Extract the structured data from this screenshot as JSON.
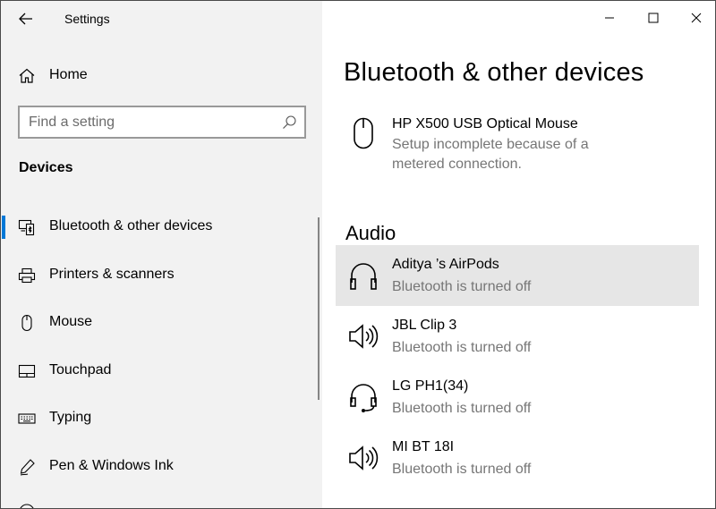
{
  "window": {
    "app_title": "Settings",
    "caption_buttons": [
      "minimize-icon",
      "maximize-icon",
      "close-icon"
    ]
  },
  "sidebar": {
    "home_label": "Home",
    "search": {
      "placeholder": "Find a setting",
      "value": ""
    },
    "section_label": "Devices",
    "items": [
      {
        "label": "Bluetooth & other devices",
        "icon": "bluetooth-devices-icon",
        "active": true
      },
      {
        "label": "Printers & scanners",
        "icon": "printer-icon",
        "active": false
      },
      {
        "label": "Mouse",
        "icon": "mouse-icon",
        "active": false
      },
      {
        "label": "Touchpad",
        "icon": "touchpad-icon",
        "active": false
      },
      {
        "label": "Typing",
        "icon": "keyboard-icon",
        "active": false
      },
      {
        "label": "Pen & Windows Ink",
        "icon": "pen-icon",
        "active": false
      }
    ]
  },
  "main": {
    "title": "Bluetooth & other devices",
    "mouse_device": {
      "name": "HP X500 USB Optical Mouse",
      "status_line1": "Setup incomplete because of a",
      "status_line2": "metered connection.",
      "icon": "mouse-icon"
    },
    "audio_section": {
      "heading": "Audio",
      "devices": [
        {
          "name": "Aditya ’s AirPods",
          "status": "Bluetooth is turned off",
          "icon": "headphones-icon",
          "selected": true
        },
        {
          "name": "JBL Clip 3",
          "status": "Bluetooth is turned off",
          "icon": "speaker-icon",
          "selected": false
        },
        {
          "name": "LG PH1(34)",
          "status": "Bluetooth is turned off",
          "icon": "headset-icon",
          "selected": false
        },
        {
          "name": "MI BT 18I",
          "status": "Bluetooth is turned off",
          "icon": "speaker-icon",
          "selected": false
        }
      ]
    }
  },
  "colors": {
    "accent": "#0078d7",
    "sidebar_bg": "#f2f2f2",
    "selected_bg": "#e6e6e6",
    "secondary_text": "#767676"
  }
}
